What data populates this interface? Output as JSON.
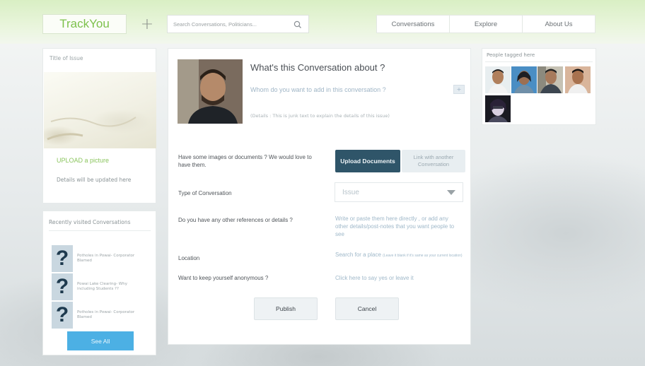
{
  "app": {
    "logo": "TrackYou",
    "add_symbol": "+"
  },
  "search": {
    "placeholder": "Search Conversations, Politicians..."
  },
  "nav": {
    "items": [
      "Conversations",
      "Explore",
      "About Us"
    ]
  },
  "issue_card": {
    "title": "Title of Issue",
    "upload_label": "UPLOAD a picture",
    "details_text": "Details will be updated here"
  },
  "recent": {
    "title": "Recently visited Conversations",
    "items": [
      {
        "icon": "?",
        "text": "Potholes in Powai- Corporator Blamed"
      },
      {
        "icon": "?",
        "text": "Powai Lake Clearing- Why including Students ??"
      },
      {
        "icon": "?",
        "text": "Potholes in Powai- Corporator Blamed"
      }
    ],
    "see_all_label": "See All"
  },
  "conversation": {
    "heading": "What's this Conversation about ?",
    "add_people_prompt": "Whom do you want to add in this conversation ?",
    "add_people_button": "+",
    "details_text": "(Details : This is junk text to explain the details of this issue)",
    "images_question": "Have some images or documents ? We would love to have them.",
    "upload_button": "Upload Documents",
    "link_button": "Link with another Conversation",
    "type_label": "Type of Conversation",
    "type_value": "Issue",
    "references_question": "Do you have any other references or details ?",
    "references_hint": "Write or paste them here directly , or add any other details/post-notes that you want people to see",
    "location_label": "Location",
    "location_hint": "Search for a place",
    "location_subhint": "(Leave it blank if it's same as your current location)",
    "anonymous_question": "Want to keep yourself anonymous ?",
    "anonymous_hint": "Click here to say yes or leave it",
    "publish_label": "Publish",
    "cancel_label": "Cancel"
  },
  "people": {
    "title": "People tagged here"
  },
  "colors": {
    "brand_green": "#7dc14c",
    "primary_dark": "#2f5569",
    "accent_blue": "#4cb0e4",
    "hint_blue": "#9fb8c9"
  }
}
